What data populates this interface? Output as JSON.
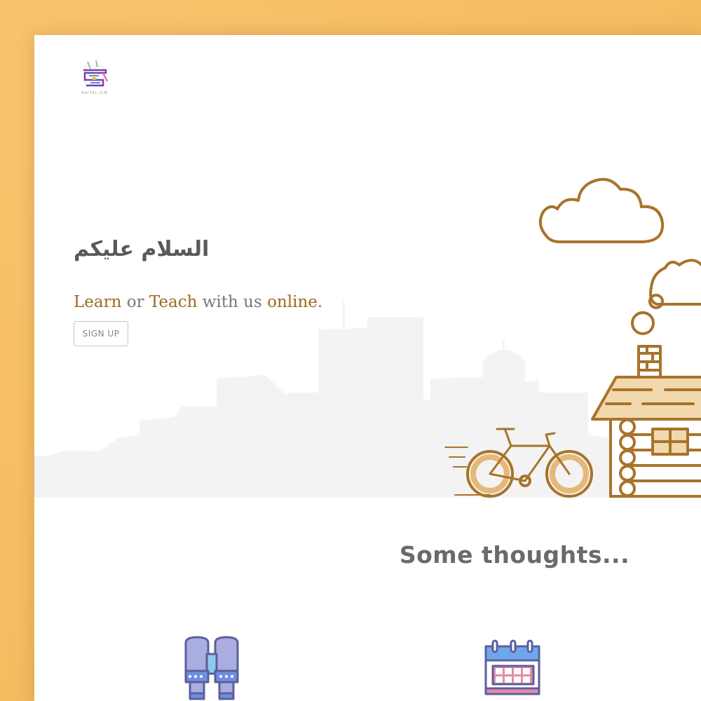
{
  "hero": {
    "greeting": "السلام عليكم",
    "tagline": {
      "part1": "Learn",
      "part2": " or ",
      "part3": "Teach",
      "part4": " with us ",
      "part5": "online",
      "part6": "."
    },
    "signup_label": "SIGN UP"
  },
  "thoughts": {
    "title": "Some thoughts..."
  },
  "logo": {
    "caption": "BAITAL·ILM"
  },
  "colors": {
    "page_background": "#f6bd63",
    "accent_brown": "#9a6a1f",
    "illustration_stroke": "#a8732a",
    "heading_gray": "#6a6a6a"
  },
  "icons": [
    "logo-icon",
    "cloud-icon",
    "house-icon",
    "bicycle-icon",
    "binoculars-icon",
    "calendar-icon"
  ]
}
